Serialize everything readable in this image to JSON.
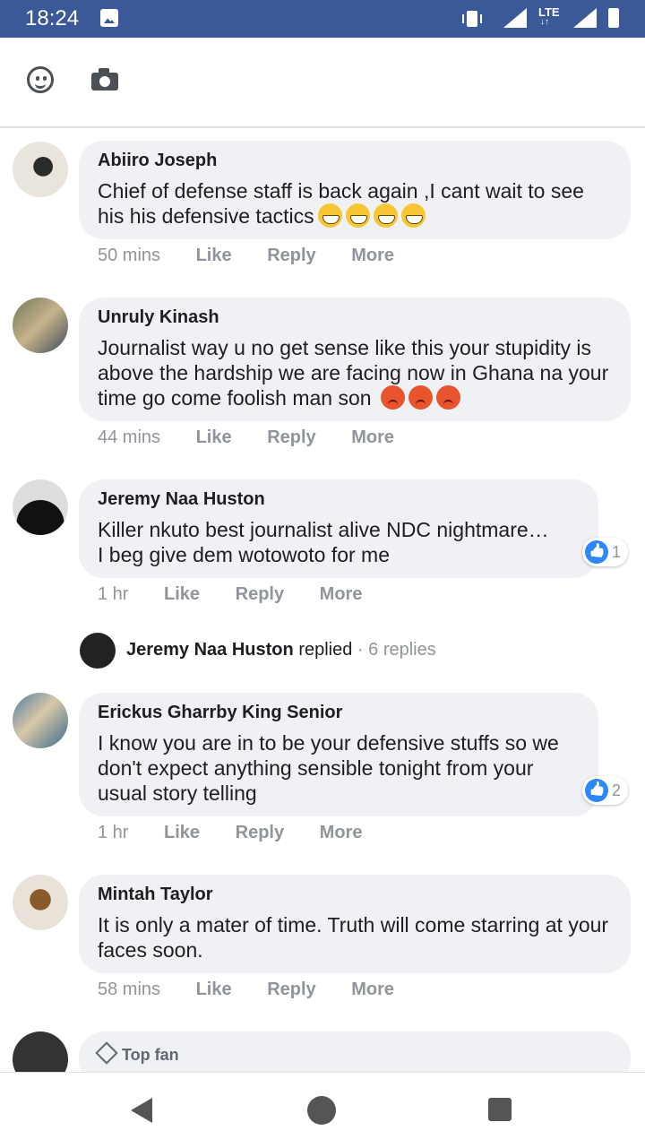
{
  "status_bar": {
    "time": "18:24",
    "network": "LTE"
  },
  "composer": {
    "emoji_icon": "smiley-face-icon",
    "camera_icon": "camera-icon"
  },
  "comments": [
    {
      "author": "Abiiro Joseph",
      "text": "Chief of defense staff is back again ,I cant wait to see his his defensive tactics",
      "emoji": "grin",
      "emoji_count": 4,
      "time": "50 mins",
      "like": "Like",
      "reply": "Reply",
      "more": "More"
    },
    {
      "author": "Unruly Kinash",
      "text": "Journalist way u no get sense like this your stupidity is above the hardship we are facing now in Ghana na your time go come foolish man son",
      "emoji": "angry",
      "emoji_count": 3,
      "time": "44 mins",
      "like": "Like",
      "reply": "Reply",
      "more": "More"
    },
    {
      "author": "Jeremy Naa Huston",
      "text": "Killer nkuto best journalist alive NDC nightmare…\nI beg give dem wotowoto for me",
      "reactions": "1",
      "time": "1 hr",
      "like": "Like",
      "reply": "Reply",
      "more": "More",
      "replies_preview": {
        "author": "Jeremy Naa Huston",
        "verb": "replied",
        "count": "· 6 replies"
      }
    },
    {
      "author": "Erickus Gharrby King Senior",
      "text": "I know you are in to be your defensive stuffs so we don't expect anything sensible tonight from your usual story telling",
      "reactions": "2",
      "time": "1 hr",
      "like": "Like",
      "reply": "Reply",
      "more": "More"
    },
    {
      "author": "Mintah Taylor",
      "text": "It is only a mater of time. Truth will come starring at your faces soon.",
      "time": "58 mins",
      "like": "Like",
      "reply": "Reply",
      "more": "More"
    },
    {
      "badge": "Top fan"
    }
  ],
  "nav": {
    "back": "back-icon",
    "home": "home-icon",
    "recents": "recents-icon"
  }
}
